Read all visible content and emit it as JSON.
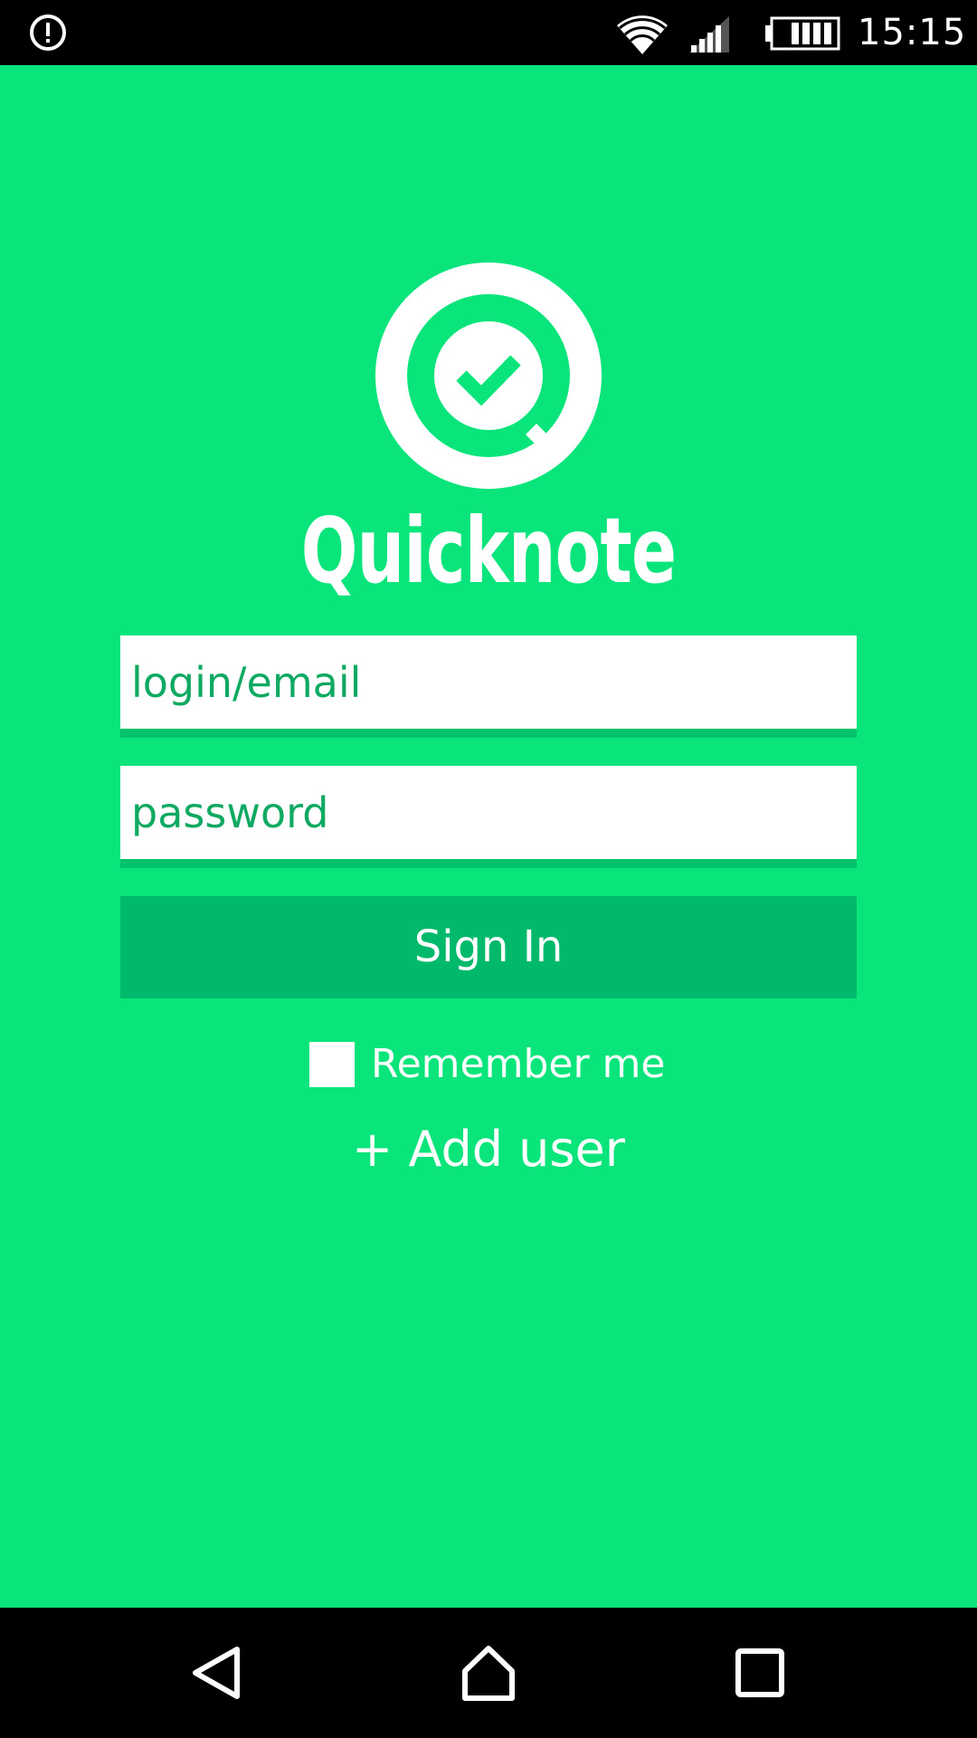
{
  "status_bar": {
    "time": "15:15",
    "icons": [
      "alert-icon",
      "wifi-icon",
      "signal-icon",
      "battery-icon"
    ]
  },
  "app": {
    "title": "Quicknote",
    "logo_icon": "check-circle-q-icon",
    "colors": {
      "background": "#09e57a",
      "button": "#00b96b",
      "field_border": "#00c26b",
      "placeholder_text": "#0fa961"
    }
  },
  "login_form": {
    "login_placeholder": "login/email",
    "login_value": "",
    "password_placeholder": "password",
    "password_value": "",
    "sign_in_label": "Sign In",
    "remember_label": "Remember me",
    "remember_checked": false,
    "add_user_label": "+ Add user"
  },
  "nav_bar": {
    "icons": [
      "back-icon",
      "home-icon",
      "recents-icon"
    ]
  }
}
